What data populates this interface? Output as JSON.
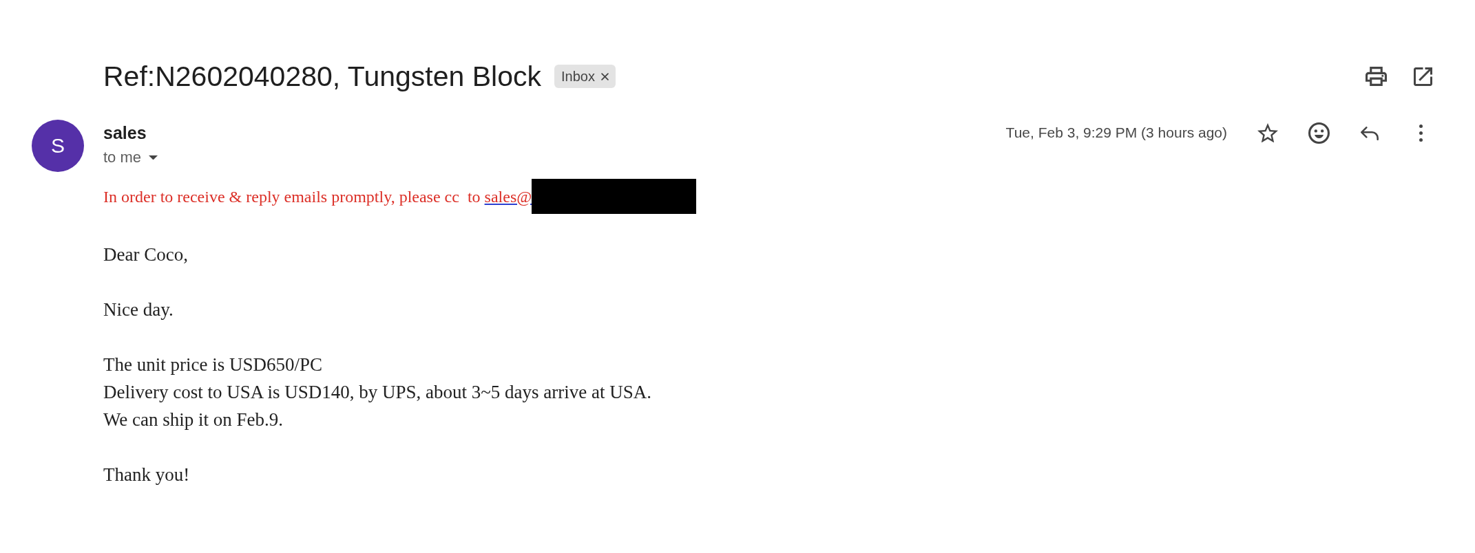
{
  "header": {
    "subject": "Ref:N2602040280, Tungsten Block",
    "label": "Inbox"
  },
  "sender": {
    "initial": "S",
    "name": "sales",
    "recipient": "to me",
    "date": "Tue, Feb 3, 9:29 PM (3 hours ago)",
    "starred": false
  },
  "notice": {
    "text": "In order to receive & reply emails promptly, please cc  to",
    "link": "sales@"
  },
  "body": {
    "paragraphs": [
      [
        "Dear Coco,"
      ],
      [
        "Nice day."
      ],
      [
        "The unit price is USD650/PC",
        "Delivery cost to USA is USD140, by UPS, about 3~5 days arrive at USA.",
        "We can ship it on Feb.9."
      ],
      [
        "Thank you!"
      ]
    ]
  }
}
